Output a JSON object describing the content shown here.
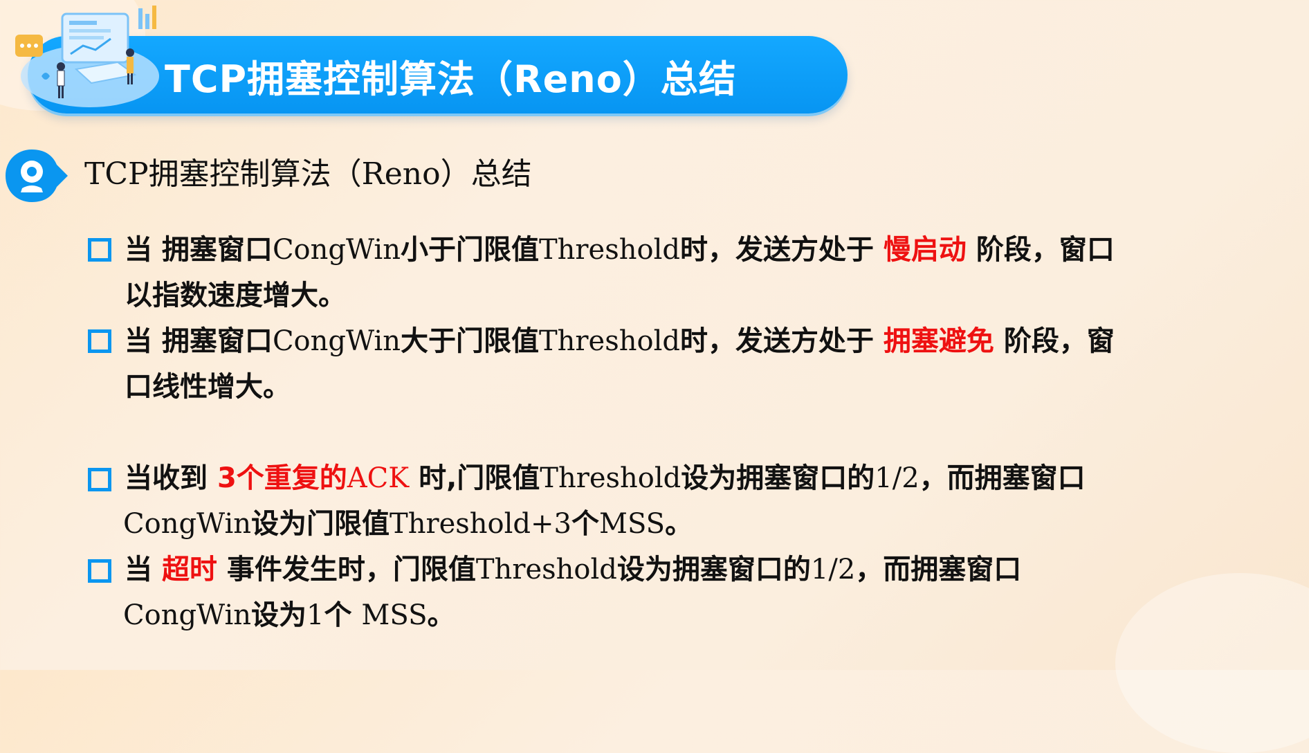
{
  "banner": {
    "title": "TCP拥塞控制算法（Reno）总结"
  },
  "section": {
    "title": "TCP拥塞控制算法（Reno）总结"
  },
  "bullets": {
    "b1": {
      "l1": {
        "a": "当 拥塞窗口",
        "b": "CongWin",
        "c": "小于门限值",
        "d": "Threshold",
        "e": "时，发送方处于 ",
        "f": "慢启动",
        "g": " 阶段，窗口"
      },
      "l2": {
        "a": "以指数速度增大。"
      }
    },
    "b2": {
      "l1": {
        "a": "当 拥塞窗口",
        "b": "CongWin",
        "c": "大于门限值",
        "d": "Threshold",
        "e": "时，发送方处于 ",
        "f": "拥塞避免",
        "g": " 阶段，窗"
      },
      "l2": {
        "a": "口线性增大。"
      }
    },
    "b3": {
      "l1": {
        "a": "当收到 ",
        "b": "3个重复的",
        "c": "ACK",
        "d": " 时,门限值",
        "e": "Threshold",
        "f": "设为拥塞窗口的",
        "g": "1/2",
        "h": "，而拥塞窗口"
      },
      "l2": {
        "a": "CongWin",
        "b": "设为门限值",
        "c": "Threshold+3",
        "d": "个",
        "e": "MSS",
        "f": "。"
      }
    },
    "b4": {
      "l1": {
        "a": "当 ",
        "b": "超时",
        "c": " 事件发生时，门限值",
        "d": "Threshold",
        "e": "设为拥塞窗口的",
        "f": "1/2",
        "g": "，而拥塞窗口"
      },
      "l2": {
        "a": "CongWin",
        "b": "设为",
        "c": "1",
        "d": "个 ",
        "e": "MSS",
        "f": "。"
      }
    }
  },
  "colors": {
    "accent_blue": "#0a96f0",
    "highlight_red": "#ee1111",
    "banner_blue": "#0795f2"
  }
}
